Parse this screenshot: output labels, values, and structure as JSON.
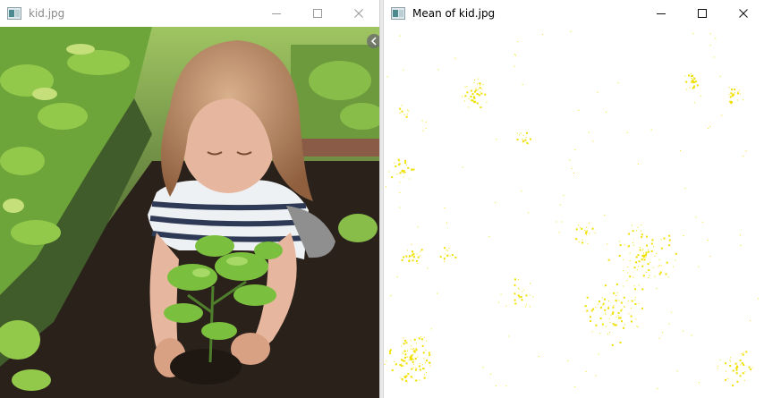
{
  "windows": {
    "left": {
      "title": "kid.jpg"
    },
    "right": {
      "title": "Mean of kid.jpg"
    }
  },
  "controls": {
    "minimize": "minimize",
    "maximize": "maximize",
    "close": "close"
  },
  "colors": {
    "soil": "#2b211b",
    "leaf": "#7fb83a",
    "leaf_light": "#b7d86a",
    "hair": "#b07a55",
    "skin": "#e6b79e",
    "stripe_dark": "#2e3a55",
    "speckle": "#f0e000",
    "output_bg": "#ffffff"
  },
  "icons": {
    "app": "image-window-icon"
  }
}
